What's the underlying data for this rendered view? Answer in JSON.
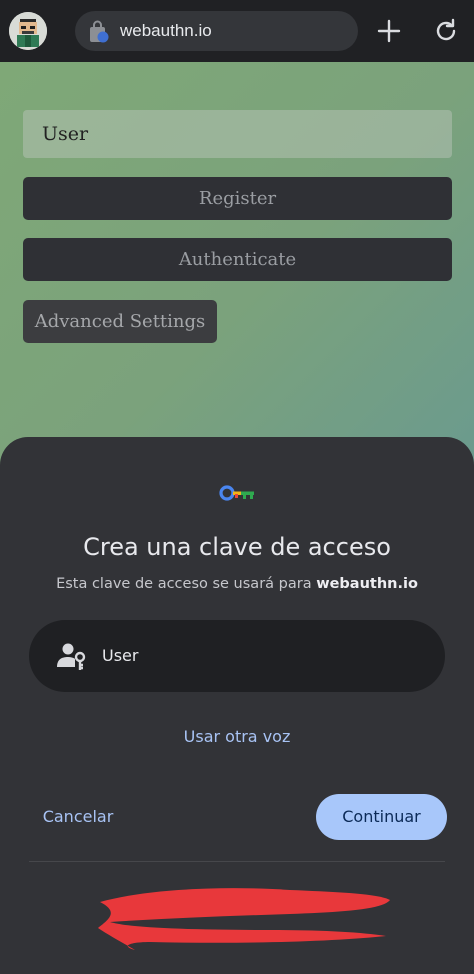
{
  "browser": {
    "url": "webauthn.io",
    "icons": {
      "avatar": "profile-avatar",
      "site_info": "site-info-icon",
      "new_tab": "plus-icon",
      "reload": "reload-icon"
    }
  },
  "page": {
    "username_value": "User",
    "register_label": "Register",
    "authenticate_label": "Authenticate",
    "advanced_settings_label": "Advanced Settings"
  },
  "passkey_sheet": {
    "title": "Crea una clave de acceso",
    "subtitle_prefix": "Esta clave de acceso se usará para ",
    "subtitle_domain": "webauthn.io",
    "account_name": "User",
    "other_way_label": "Usar otra voz",
    "cancel_label": "Cancelar",
    "continue_label": "Continuar",
    "icons": {
      "header": "passkey-key-icon",
      "account": "person-key-icon"
    }
  },
  "colors": {
    "accent": "#a8c7fa",
    "link": "#a8c3f4",
    "sheet_background": "#323337",
    "redaction": "#e8383b"
  }
}
